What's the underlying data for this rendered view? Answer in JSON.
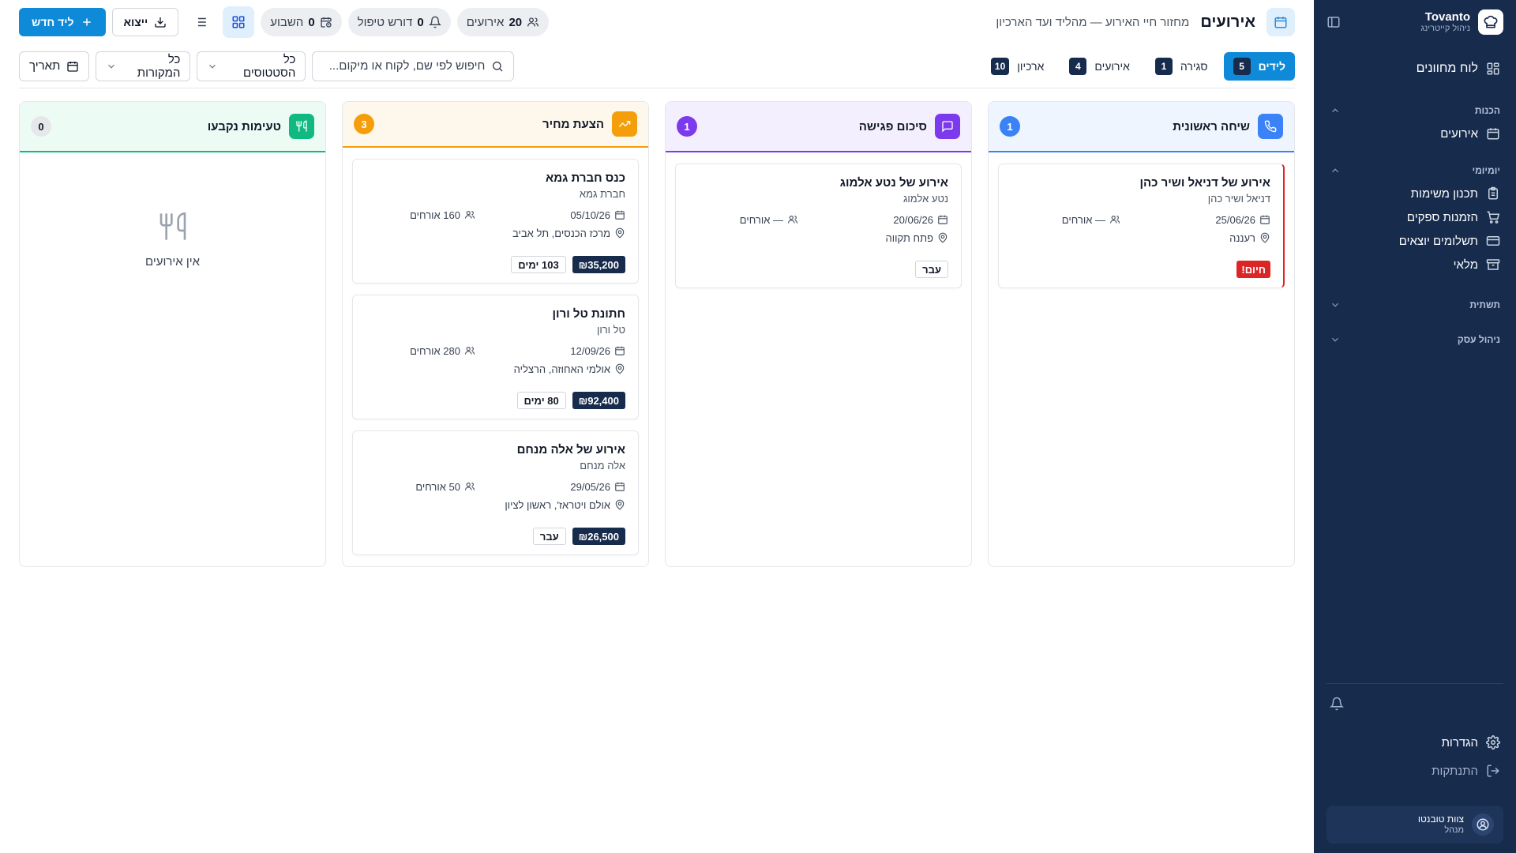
{
  "sidebar": {
    "brand_name": "Tovanto",
    "brand_sub": "ניהול קייטרינג",
    "dashboard": "לוח מחוונים",
    "groups": [
      {
        "label": "הכנות",
        "items": [
          {
            "label": "אירועים",
            "icon": "calendar-icon"
          }
        ]
      },
      {
        "label": "יומיומי",
        "items": [
          {
            "label": "תכנון משימות",
            "icon": "clipboard-icon"
          },
          {
            "label": "הזמנות ספקים",
            "icon": "cart-icon"
          },
          {
            "label": "תשלומים יוצאים",
            "icon": "credit-card-icon"
          },
          {
            "label": "מלאי",
            "icon": "archive-icon"
          }
        ]
      },
      {
        "label": "תשתית",
        "items": []
      },
      {
        "label": "ניהול עסק",
        "items": []
      }
    ],
    "settings": "הגדרות",
    "logout": "התנתקות",
    "user_name": "צוות טובנטו",
    "user_role": "מנהל"
  },
  "header": {
    "title": "אירועים",
    "subtitle": "מחזור חיי האירוע — מהליד ועד הארכיון",
    "events_count": "20",
    "events_label": "אירועים",
    "attention_count": "0",
    "attention_label": "דורש טיפול",
    "week_count": "0",
    "week_label": "השבוע",
    "export_label": "ייצוא",
    "new_lead_label": "ליד חדש"
  },
  "filters": {
    "stages": [
      {
        "label": "לידים",
        "count": "5",
        "active": true
      },
      {
        "label": "סגירה",
        "count": "1",
        "active": false
      },
      {
        "label": "אירועים",
        "count": "4",
        "active": false
      },
      {
        "label": "ארכיון",
        "count": "10",
        "active": false
      }
    ],
    "search_placeholder": "חיפוש לפי שם, לקוח או מיקום...",
    "status_select": "כל הסטטוסים",
    "source_select": "כל המקורות",
    "date_label": "תאריך"
  },
  "columns": [
    {
      "title": "שיחה ראשונית",
      "count": "1",
      "color": "#3b82f6",
      "bg": "#eef5fe",
      "icon": "phone-icon",
      "cards": [
        {
          "title": "אירוע של דניאל ושיר כהן",
          "client": "דניאל ושיר כהן",
          "date": "25/06/26",
          "guests": "— אורחים",
          "location": "רעננה",
          "alert": "חיום!"
        }
      ]
    },
    {
      "title": "סיכום פגישה",
      "count": "1",
      "color": "#7c3aed",
      "bg": "#f4efff",
      "icon": "chat-icon",
      "cards": [
        {
          "title": "אירוע של נטע אלמוג",
          "client": "נטע אלמוג",
          "date": "20/06/26",
          "guests": "— אורחים",
          "location": "פתח תקווה",
          "tag": "עבר"
        }
      ]
    },
    {
      "title": "הצעת מחיר",
      "count": "3",
      "color": "#f59e0b",
      "bg": "#fef8ec",
      "icon": "trend-icon",
      "cards": [
        {
          "title": "כנס חברת גמא",
          "client": "חברת גמא",
          "date": "05/10/26",
          "guests": "160 אורחים",
          "location": "מרכז הכנסים, תל אביב",
          "price": "₪35,200",
          "tag": "103 ימים"
        },
        {
          "title": "חתונת טל ורון",
          "client": "טל ורון",
          "date": "12/09/26",
          "guests": "280 אורחים",
          "location": "אולמי האחוזה, הרצליה",
          "price": "₪92,400",
          "tag": "80 ימים"
        },
        {
          "title": "אירוע של אלה מנחם",
          "client": "אלה מנחם",
          "date": "29/05/26",
          "guests": "50 אורחים",
          "location": "אולם ויטראז', ראשון לציון",
          "price": "₪26,500",
          "tag": "עבר"
        }
      ]
    },
    {
      "title": "טעימות נקבעו",
      "count": "0",
      "color": "#10b981",
      "bg": "#edfbf5",
      "icon": "utensils-icon",
      "cards": [],
      "empty": "אין אירועים"
    }
  ]
}
